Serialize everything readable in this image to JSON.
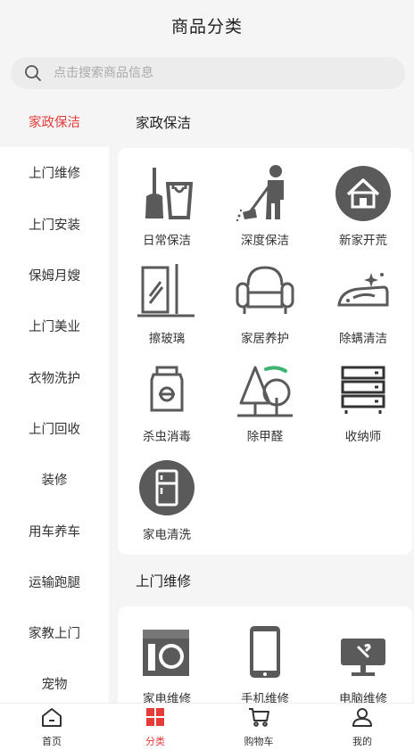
{
  "header": {
    "title": "商品分类"
  },
  "search": {
    "placeholder": "点击搜索商品信息"
  },
  "sidebar": {
    "items": [
      {
        "label": "家政保洁",
        "active": true
      },
      {
        "label": "上门维修",
        "active": false
      },
      {
        "label": "上门安装",
        "active": false
      },
      {
        "label": "保姆月嫂",
        "active": false
      },
      {
        "label": "上门美业",
        "active": false
      },
      {
        "label": "衣物洗护",
        "active": false
      },
      {
        "label": "上门回收",
        "active": false
      },
      {
        "label": "装修",
        "active": false
      },
      {
        "label": "用车养车",
        "active": false
      },
      {
        "label": "运输跑腿",
        "active": false
      },
      {
        "label": "家教上门",
        "active": false
      },
      {
        "label": "宠物",
        "active": false
      }
    ]
  },
  "sections": [
    {
      "title": "家政保洁",
      "items": [
        {
          "label": "日常保洁",
          "icon": "broom-bucket-icon"
        },
        {
          "label": "深度保洁",
          "icon": "person-sweeping-icon"
        },
        {
          "label": "新家开荒",
          "icon": "house-circle-icon"
        },
        {
          "label": "擦玻璃",
          "icon": "window-glass-icon"
        },
        {
          "label": "家居养护",
          "icon": "sofa-icon"
        },
        {
          "label": "除螨清洁",
          "icon": "iron-sparkle-icon"
        },
        {
          "label": "杀虫消毒",
          "icon": "disinfectant-jar-icon"
        },
        {
          "label": "除甲醛",
          "icon": "trees-icon"
        },
        {
          "label": "收纳师",
          "icon": "drawers-icon"
        },
        {
          "label": "家电清洗",
          "icon": "fridge-circle-icon"
        }
      ]
    },
    {
      "title": "上门维修",
      "items": [
        {
          "label": "家电维修",
          "icon": "washing-machine-icon"
        },
        {
          "label": "手机维修",
          "icon": "phone-icon"
        },
        {
          "label": "电脑维修",
          "icon": "computer-wrench-icon"
        }
      ]
    }
  ],
  "tabbar": {
    "tabs": [
      {
        "label": "首页",
        "icon": "home-icon",
        "active": false
      },
      {
        "label": "分类",
        "icon": "category-grid-icon",
        "active": true
      },
      {
        "label": "购物车",
        "icon": "cart-icon",
        "active": false
      },
      {
        "label": "我的",
        "icon": "user-icon",
        "active": false
      }
    ]
  },
  "colors": {
    "accent": "#e43b3b",
    "icon": "#5a5a5a",
    "green": "#3cb371",
    "background": "#f5f5f5"
  }
}
